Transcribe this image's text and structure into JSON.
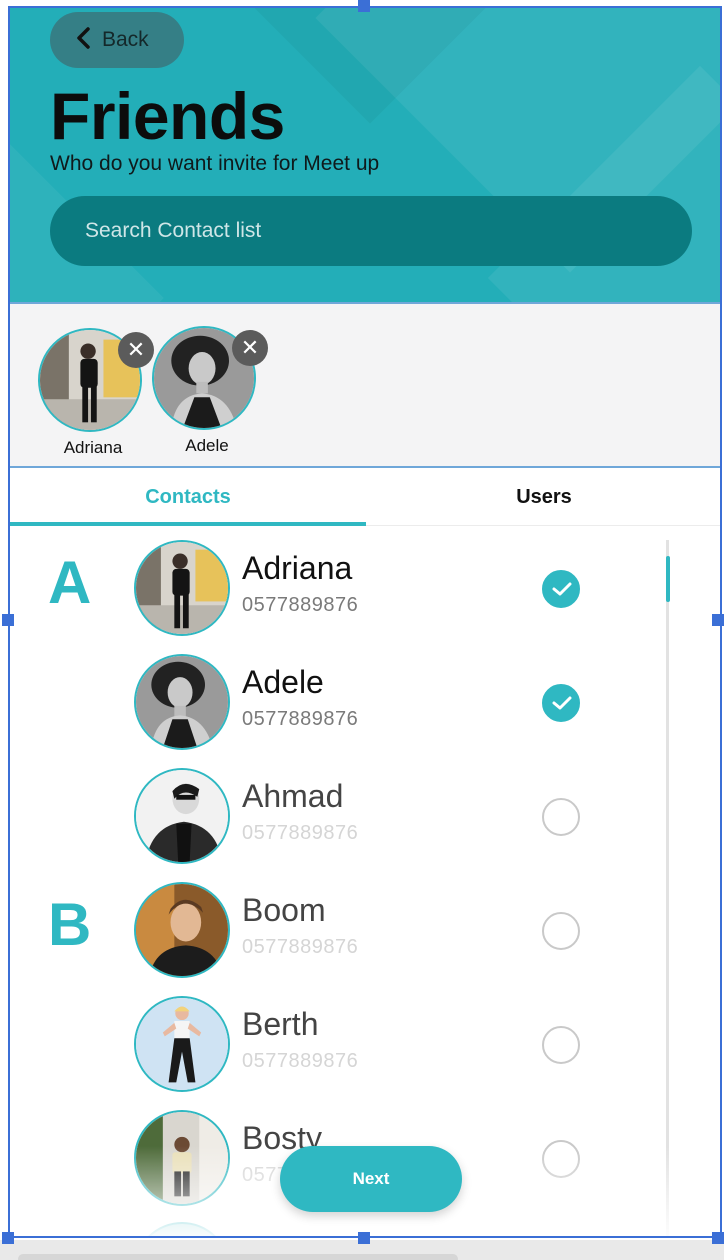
{
  "header": {
    "back_label": "Back",
    "title": "Friends",
    "subtitle": "Who do you want invite for Meet up",
    "search_placeholder": "Search Contact list"
  },
  "selected": [
    {
      "name": "Adriana",
      "remove_icon": "close-icon"
    },
    {
      "name": "Adele",
      "remove_icon": "close-icon"
    }
  ],
  "tabs": [
    {
      "label": "Contacts",
      "active": true
    },
    {
      "label": "Users",
      "active": false
    }
  ],
  "sections": [
    "A",
    "B"
  ],
  "contacts": [
    {
      "name": "Adriana",
      "phone": "0577889876",
      "checked": true
    },
    {
      "name": "Adele",
      "phone": "0577889876",
      "checked": true
    },
    {
      "name": "Ahmad",
      "phone": "0577889876",
      "checked": false
    },
    {
      "name": "Boom",
      "phone": "0577889876",
      "checked": false
    },
    {
      "name": "Berth",
      "phone": "0577889876",
      "checked": false
    },
    {
      "name": "Bosty",
      "phone": "0577889876",
      "checked": false
    }
  ],
  "next_label": "Next",
  "colors": {
    "accent": "#2fb8c2",
    "header_bg": "#23aeb8",
    "search_bg": "#0b7b80",
    "selection_frame": "#3b6fd6"
  }
}
